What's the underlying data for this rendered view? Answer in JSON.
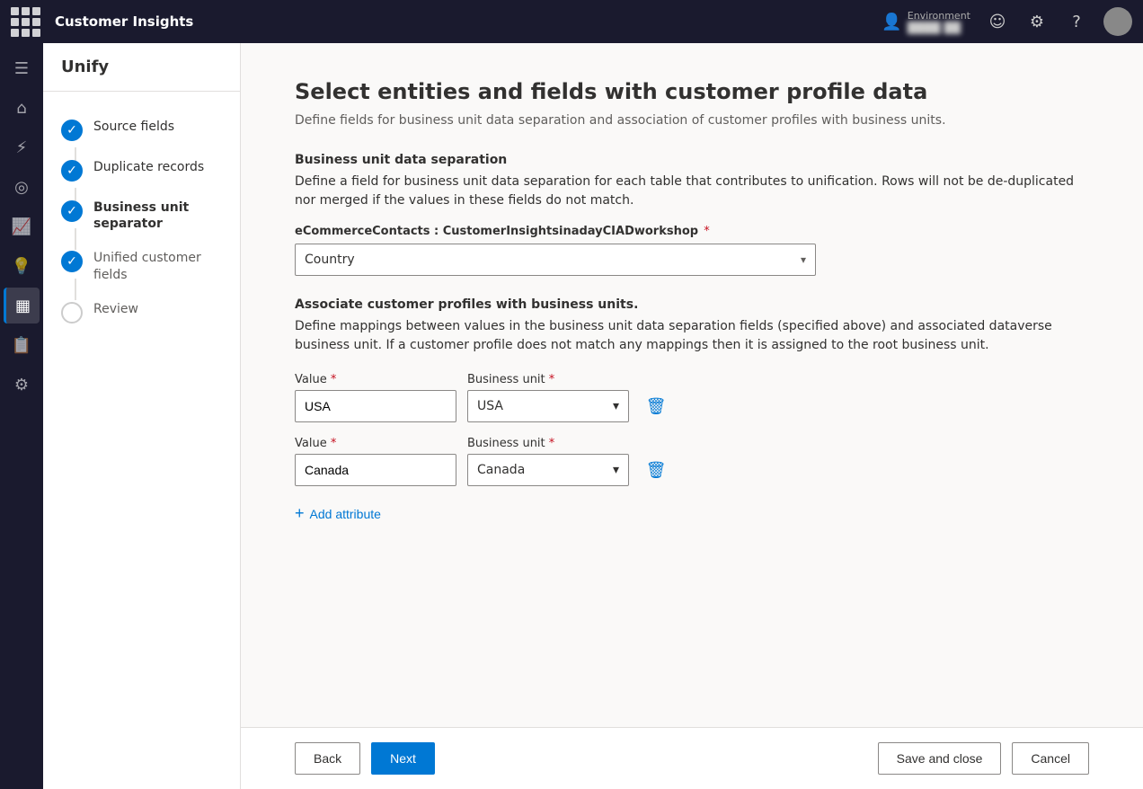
{
  "app": {
    "title": "Customer Insights",
    "grid_icon": "apps-icon"
  },
  "topnav": {
    "env_label": "Environment",
    "env_value": "████ ██",
    "icons": [
      "person-icon",
      "settings-icon",
      "help-icon"
    ]
  },
  "page": {
    "header": "Unify",
    "title": "Select entities and fields with customer profile data",
    "subtitle": "Define fields for business unit data separation and association of customer profiles with business units."
  },
  "steps": [
    {
      "id": "source-fields",
      "label": "Source fields",
      "state": "completed",
      "bold": false
    },
    {
      "id": "duplicate-records",
      "label": "Duplicate records",
      "state": "completed",
      "bold": false
    },
    {
      "id": "business-unit-separator",
      "label": "Business unit separator",
      "state": "active",
      "bold": true
    },
    {
      "id": "unified-customer-fields",
      "label": "Unified customer fields",
      "state": "completed",
      "bold": false
    },
    {
      "id": "review",
      "label": "Review",
      "state": "pending",
      "bold": false
    }
  ],
  "sections": {
    "separation": {
      "title": "Business unit data separation",
      "description": "Define a field for business unit data separation for each table that contributes to unification. Rows will not be de-duplicated nor merged if the values in these fields do not match.",
      "entity_label_prefix": "eCommerceContacts : CustomerInsightsinadayCIADworkshop",
      "required": true,
      "dropdown_value": "Country"
    },
    "association": {
      "title": "Associate customer profiles with business units.",
      "description": "Define mappings between values in the business unit data separation fields (specified above) and associated dataverse business unit. If a customer profile does not match any mappings then it is assigned to the root business unit.",
      "rows": [
        {
          "value_label": "Value",
          "value": "USA",
          "unit_label": "Business unit",
          "unit_value": "USA"
        },
        {
          "value_label": "Value",
          "value": "Canada",
          "unit_label": "Business unit",
          "unit_value": "Canada"
        }
      ],
      "add_btn": "Add attribute"
    }
  },
  "footer": {
    "back_label": "Back",
    "next_label": "Next",
    "save_close_label": "Save and close",
    "cancel_label": "Cancel"
  },
  "icon_sidebar": [
    {
      "id": "grid-icon",
      "symbol": "⊞"
    },
    {
      "id": "home-icon",
      "symbol": "⌂"
    },
    {
      "id": "analytics-icon",
      "symbol": "⋮⋮"
    },
    {
      "id": "target-icon",
      "symbol": "◎"
    },
    {
      "id": "chart-icon",
      "symbol": "📈"
    },
    {
      "id": "bulb-icon",
      "symbol": "💡"
    },
    {
      "id": "data-icon",
      "symbol": "▦"
    },
    {
      "id": "report-icon",
      "symbol": "📋"
    },
    {
      "id": "settings-icon",
      "symbol": "⚙"
    }
  ]
}
